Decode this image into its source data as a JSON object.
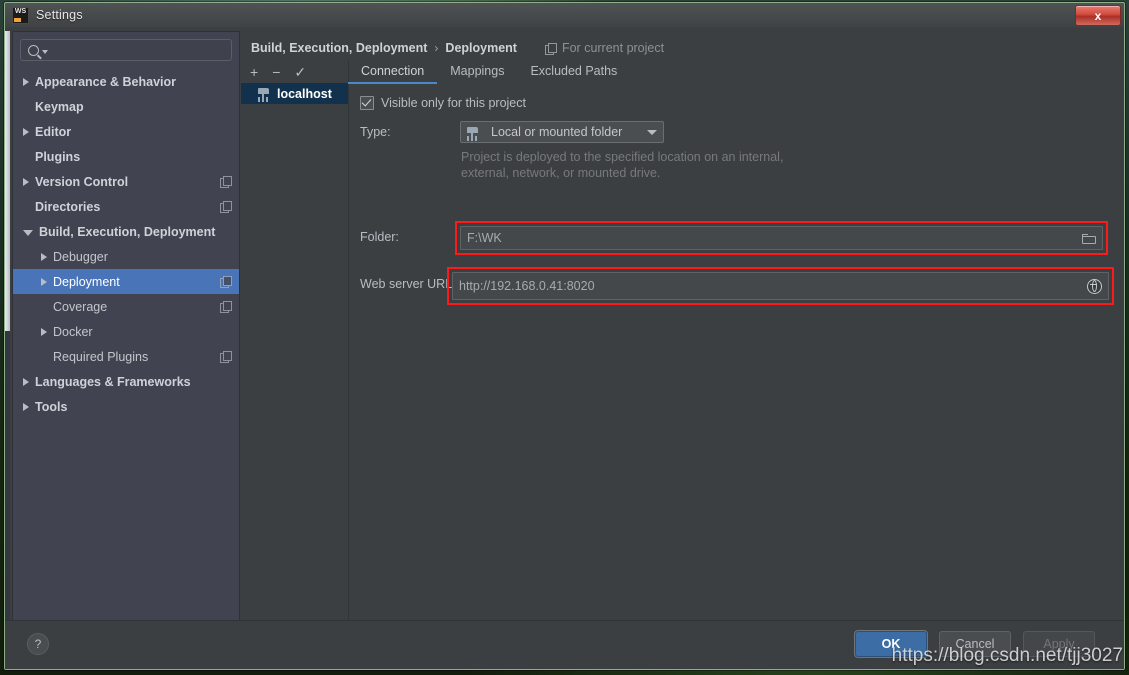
{
  "window": {
    "title": "Settings",
    "app_icon": "webstorm-icon",
    "close_label": "x"
  },
  "sidebar": {
    "search": {
      "placeholder": "",
      "value": "",
      "icon": "search-icon"
    },
    "items": [
      {
        "label": "Appearance & Behavior",
        "arrow": "right",
        "bold": true,
        "indent": 0,
        "config_badge": false
      },
      {
        "label": "Keymap",
        "arrow": "none",
        "bold": true,
        "indent": 0,
        "config_badge": false
      },
      {
        "label": "Editor",
        "arrow": "right",
        "bold": true,
        "indent": 0,
        "config_badge": false
      },
      {
        "label": "Plugins",
        "arrow": "none",
        "bold": true,
        "indent": 0,
        "config_badge": false
      },
      {
        "label": "Version Control",
        "arrow": "right",
        "bold": true,
        "indent": 0,
        "config_badge": true
      },
      {
        "label": "Directories",
        "arrow": "none",
        "bold": true,
        "indent": 0,
        "config_badge": true
      },
      {
        "label": "Build, Execution, Deployment",
        "arrow": "down",
        "bold": true,
        "indent": 0,
        "config_badge": false
      },
      {
        "label": "Debugger",
        "arrow": "right",
        "bold": false,
        "indent": 1,
        "config_badge": false
      },
      {
        "label": "Deployment",
        "arrow": "right",
        "bold": false,
        "indent": 1,
        "config_badge": true,
        "selected": true
      },
      {
        "label": "Coverage",
        "arrow": "none",
        "bold": false,
        "indent": 1,
        "config_badge": true
      },
      {
        "label": "Docker",
        "arrow": "right",
        "bold": false,
        "indent": 1,
        "config_badge": false
      },
      {
        "label": "Required Plugins",
        "arrow": "none",
        "bold": false,
        "indent": 1,
        "config_badge": true
      },
      {
        "label": "Languages & Frameworks",
        "arrow": "right",
        "bold": true,
        "indent": 0,
        "config_badge": false
      },
      {
        "label": "Tools",
        "arrow": "right",
        "bold": true,
        "indent": 0,
        "config_badge": false
      }
    ]
  },
  "breadcrumb": {
    "root": "Build, Execution, Deployment",
    "separator": "›",
    "leaf": "Deployment",
    "scope_label": "For current project",
    "scope_icon": "copy-pages-icon"
  },
  "hosts": {
    "toolbar": {
      "add": "+",
      "remove": "−",
      "set_default": "✓"
    },
    "items": [
      {
        "label": "localhost",
        "icon": "network-folder-icon",
        "selected": true
      }
    ]
  },
  "tabs": [
    {
      "label": "Connection",
      "active": true
    },
    {
      "label": "Mappings",
      "active": false
    },
    {
      "label": "Excluded Paths",
      "active": false
    }
  ],
  "form": {
    "visible_only_checkbox": {
      "label": "Visible only for this project",
      "checked": true
    },
    "type": {
      "label": "Type:",
      "value": "Local or mounted folder",
      "icon": "network-folder-icon",
      "caret": "chevron-down-icon"
    },
    "hint_line1": "Project is deployed to the specified location on an internal,",
    "hint_line2": "external, network, or mounted drive.",
    "folder": {
      "label": "Folder:",
      "value": "F:\\WK",
      "browse_icon": "folder-open-icon",
      "highlighted": true
    },
    "web_server_url": {
      "label": "Web server URL:",
      "value": "http://192.168.0.41:8020",
      "open_icon": "globe-icon",
      "highlighted": true
    }
  },
  "footer": {
    "help": "?",
    "ok": "OK",
    "cancel": "Cancel",
    "apply": "Apply"
  },
  "watermark": "https://blog.csdn.net/tjj3027",
  "colors": {
    "panel_bg": "#3c3f41",
    "sidebar_bg": "#414450",
    "selection_blue": "#4a74b8",
    "host_selection": "#11314c",
    "tab_underline": "#4a88c7",
    "ok_button": "#3c6ea5",
    "highlight_box": "#ff1a1a"
  }
}
